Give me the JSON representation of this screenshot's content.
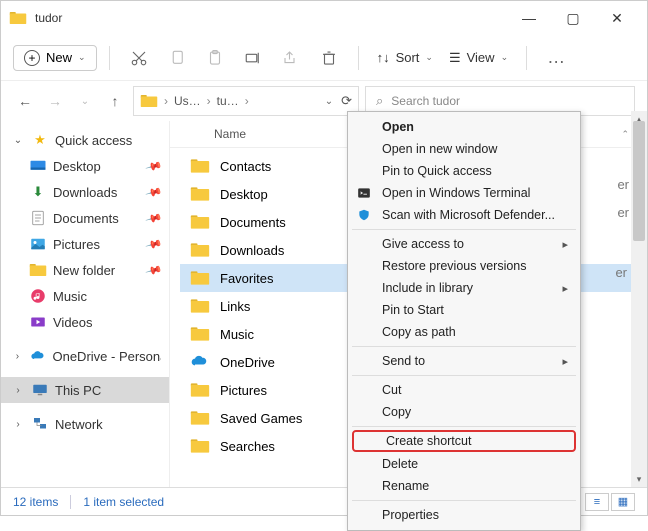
{
  "window": {
    "title": "tudor"
  },
  "toolbar": {
    "new_label": "New",
    "sort_label": "Sort",
    "view_label": "View"
  },
  "breadcrumb": {
    "seg1": "Us…",
    "seg2": "tu…"
  },
  "search": {
    "placeholder": "Search tudor"
  },
  "sidebar": {
    "quick_access": "Quick access",
    "desktop": "Desktop",
    "downloads": "Downloads",
    "documents": "Documents",
    "pictures": "Pictures",
    "new_folder": "New folder",
    "music": "Music",
    "videos": "Videos",
    "onedrive": "OneDrive - Personal",
    "this_pc": "This PC",
    "network": "Network"
  },
  "columns": {
    "name": "Name"
  },
  "files": [
    {
      "label": "Contacts"
    },
    {
      "label": "Desktop"
    },
    {
      "label": "Documents"
    },
    {
      "label": "Downloads"
    },
    {
      "label": "Favorites",
      "selected": true
    },
    {
      "label": "Links"
    },
    {
      "label": "Music"
    },
    {
      "label": "OneDrive",
      "cloud": true
    },
    {
      "label": "Pictures"
    },
    {
      "label": "Saved Games"
    },
    {
      "label": "Searches"
    }
  ],
  "partial_column": {
    "a": "er",
    "b": "er",
    "c": "er"
  },
  "context_menu": {
    "open": "Open",
    "open_new": "Open in new window",
    "pin_qa": "Pin to Quick access",
    "open_terminal": "Open in Windows Terminal",
    "scan_defender": "Scan with Microsoft Defender...",
    "give_access": "Give access to",
    "restore_prev": "Restore previous versions",
    "include_lib": "Include in library",
    "pin_start": "Pin to Start",
    "copy_path": "Copy as path",
    "send_to": "Send to",
    "cut": "Cut",
    "copy": "Copy",
    "create_shortcut": "Create shortcut",
    "delete": "Delete",
    "rename": "Rename",
    "properties": "Properties"
  },
  "status": {
    "items": "12 items",
    "selected": "1 item selected"
  }
}
